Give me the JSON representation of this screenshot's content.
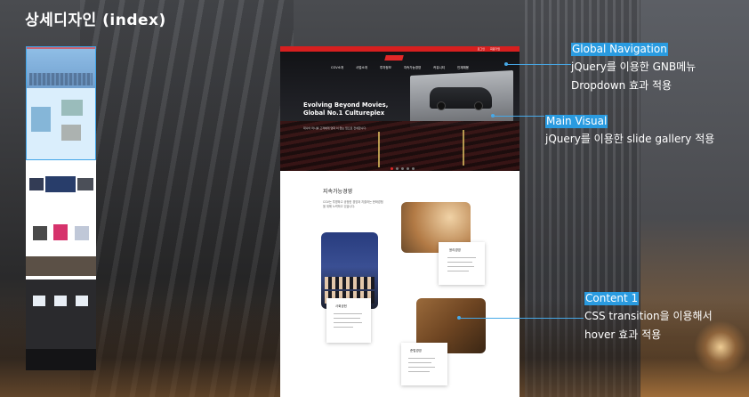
{
  "page_title": "상세디자인 (index)",
  "mockup": {
    "topbar_links": [
      "로그인",
      "회원가입"
    ],
    "gnb": [
      "CGV소개",
      "사업소개",
      "투자정보",
      "지속가능경영",
      "커뮤니티",
      "인재채용"
    ],
    "hero": {
      "title_line1": "Evolving Beyond Movies,",
      "title_line2": "Global No.1 Cultureplex",
      "subtitle": "대나아 머니를 고객에게 영화 이 없는 입으로 전세합니다."
    },
    "section": {
      "title": "지속가능경영",
      "desc": "CGV는 투명하고 공정한 경영과 지출하는 문화경험을 위해 노력하고 있습니다."
    },
    "cards": [
      {
        "title": "윤리경영"
      },
      {
        "title": "사회공헌"
      },
      {
        "title": "준법경영"
      }
    ]
  },
  "annotations": [
    {
      "title": "Global Navigation",
      "lines": [
        "jQuery를 이용한 GNB메뉴",
        "Dropdown 효과 적용"
      ]
    },
    {
      "title": "Main Visual",
      "lines": [
        "jQuery를 이용한 slide gallery 적용"
      ]
    },
    {
      "title": "Content 1",
      "lines": [
        "CSS transition을 이용해서",
        "hover 효과 적용"
      ]
    }
  ],
  "colors": {
    "accent": "#d71f1f",
    "annotation": "#2a9be0"
  }
}
